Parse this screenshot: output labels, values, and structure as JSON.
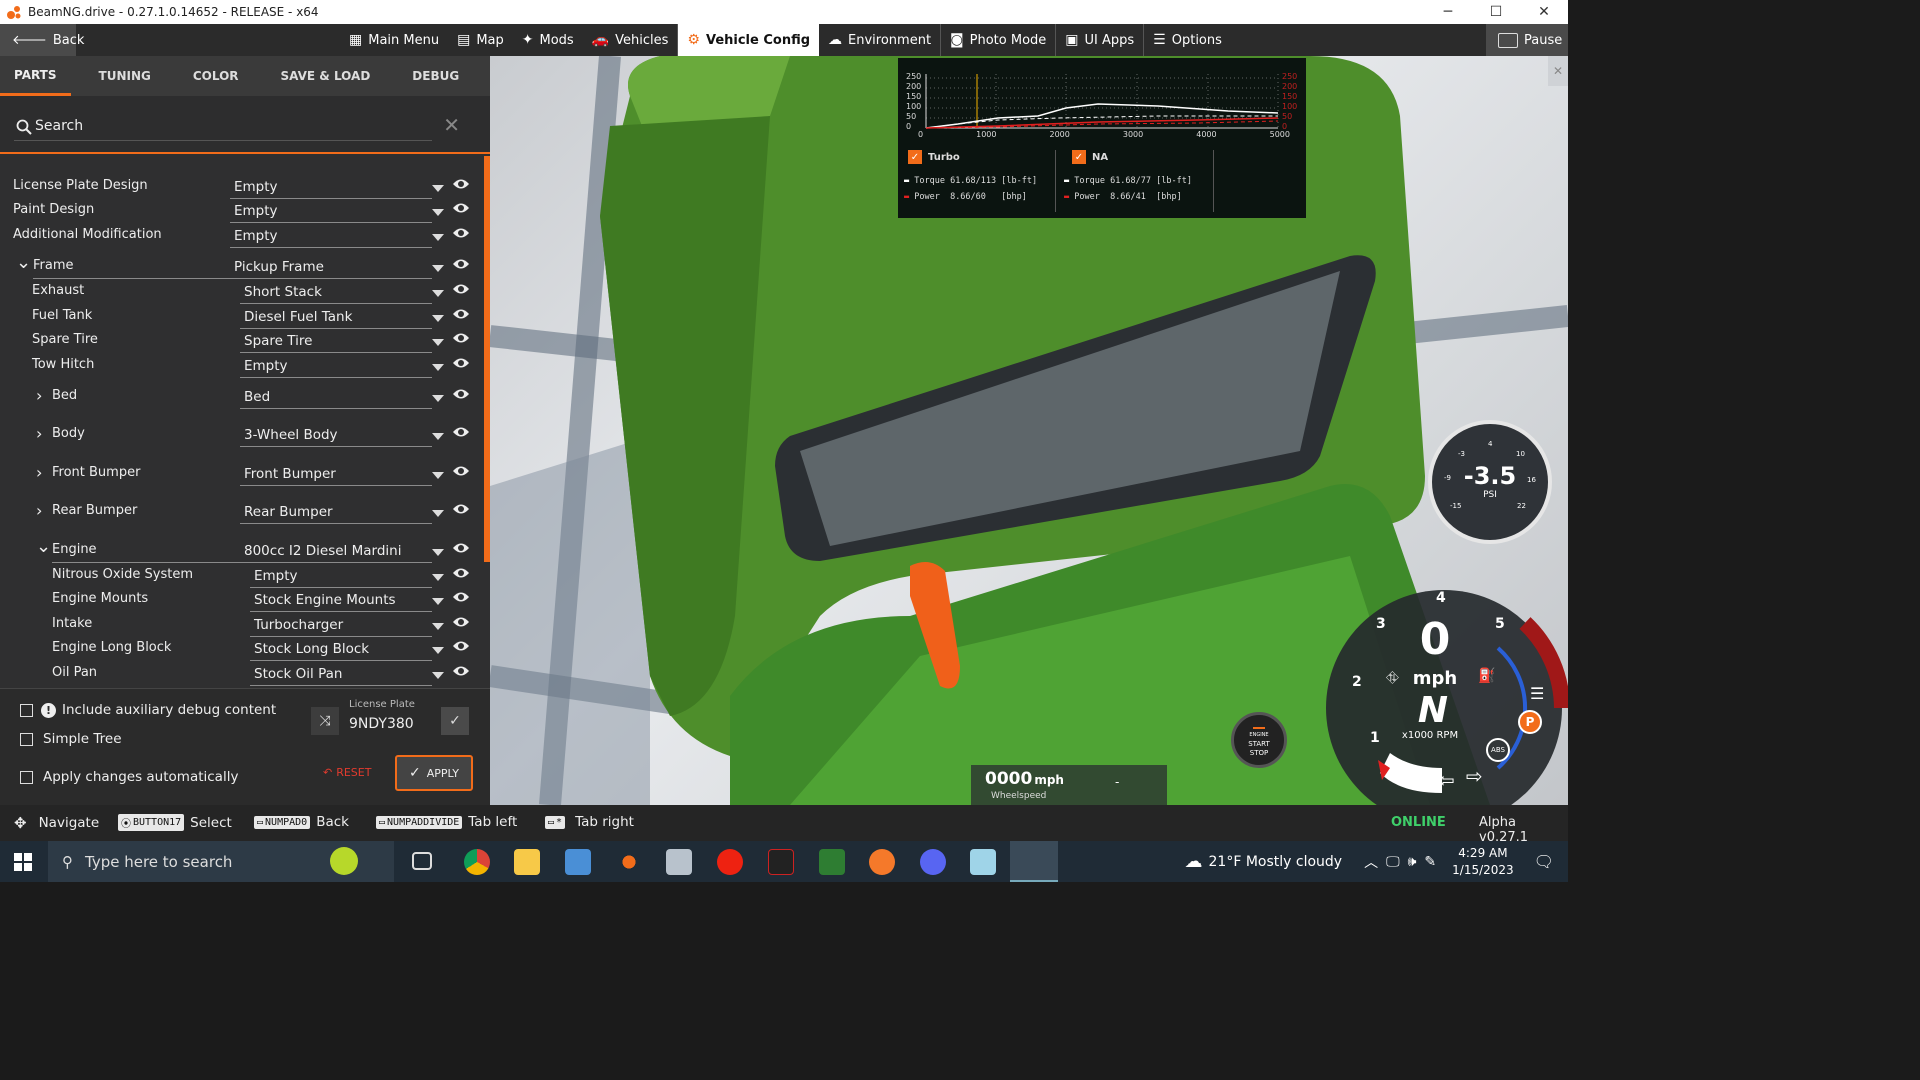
{
  "window": {
    "title": "BeamNG.drive - 0.27.1.0.14652 - RELEASE - x64",
    "minimize": "─",
    "maximize": "☐",
    "close": "✕"
  },
  "topbar": {
    "back": "Back",
    "pause": "Pause",
    "menu": [
      {
        "label": "Main Menu",
        "icon": "grid-icon"
      },
      {
        "label": "Map",
        "icon": "map-icon"
      },
      {
        "label": "Mods",
        "icon": "puzzle-icon"
      },
      {
        "label": "Vehicles",
        "icon": "car-icon"
      },
      {
        "label": "Vehicle Config",
        "icon": "engine-icon",
        "active": true
      },
      {
        "label": "Environment",
        "icon": "weather-icon"
      },
      {
        "label": "Photo Mode",
        "icon": "camera-icon"
      },
      {
        "label": "UI Apps",
        "icon": "apps-icon"
      },
      {
        "label": "Options",
        "icon": "sliders-icon"
      }
    ]
  },
  "tabs": [
    "PARTS",
    "TUNING",
    "COLOR",
    "SAVE & LOAD",
    "DEBUG"
  ],
  "search": {
    "placeholder": "Search"
  },
  "parts": [
    {
      "label": "License Plate Design",
      "value": "Empty",
      "level": 0,
      "chevron": ""
    },
    {
      "label": "Paint Design",
      "value": "Empty",
      "level": 0,
      "chevron": ""
    },
    {
      "label": "Additional Modification",
      "value": "Empty",
      "level": 0,
      "chevron": ""
    },
    {
      "label": "Frame",
      "value": "Pickup Frame",
      "level": 0,
      "chevron": "open"
    },
    {
      "label": "Exhaust",
      "value": "Short Stack",
      "level": 1,
      "chevron": ""
    },
    {
      "label": "Fuel Tank",
      "value": "Diesel Fuel Tank",
      "level": 1,
      "chevron": ""
    },
    {
      "label": "Spare Tire",
      "value": "Spare Tire",
      "level": 1,
      "chevron": ""
    },
    {
      "label": "Tow Hitch",
      "value": "Empty",
      "level": 1,
      "chevron": ""
    },
    {
      "label": "Bed",
      "value": "Bed",
      "level": 1,
      "chevron": "closed"
    },
    {
      "label": "Body",
      "value": "3-Wheel Body",
      "level": 1,
      "chevron": "closed"
    },
    {
      "label": "Front Bumper",
      "value": "Front Bumper",
      "level": 1,
      "chevron": "closed"
    },
    {
      "label": "Rear Bumper",
      "value": "Rear Bumper",
      "level": 1,
      "chevron": "closed"
    },
    {
      "label": "Engine",
      "value": "800cc I2 Diesel Mardini",
      "level": 1,
      "chevron": "open"
    },
    {
      "label": "Nitrous Oxide System",
      "value": "Empty",
      "level": 2,
      "chevron": ""
    },
    {
      "label": "Engine Mounts",
      "value": "Stock Engine Mounts",
      "level": 2,
      "chevron": ""
    },
    {
      "label": "Intake",
      "value": "Turbocharger",
      "level": 2,
      "chevron": ""
    },
    {
      "label": "Engine Long Block",
      "value": "Stock Long Block",
      "level": 2,
      "chevron": ""
    },
    {
      "label": "Oil Pan",
      "value": "Stock Oil Pan",
      "level": 2,
      "chevron": ""
    }
  ],
  "options": {
    "debug": "Include auxiliary debug content",
    "simple_tree": "Simple Tree",
    "auto_apply": "Apply changes automatically",
    "license_label": "License Plate",
    "license_value": "9NDY380",
    "reset": "RESET",
    "apply": "APPLY"
  },
  "statusbar": {
    "navigate": "Navigate",
    "select_key": "BUTTON17",
    "select": "Select",
    "back_key": "NUMPAD0",
    "back": "Back",
    "tab_left_key": "NUMPADDIVIDE",
    "tab_left": "Tab left",
    "tab_right_key": "*",
    "tab_right": "Tab right",
    "online": "ONLINE",
    "version": "Alpha v0.27.1"
  },
  "graph": {
    "y_left": [
      "250",
      "200",
      "150",
      "100",
      "50",
      "0"
    ],
    "y_right": [
      "250",
      "200",
      "150",
      "100",
      "50",
      "0"
    ],
    "x": [
      "0",
      "1000",
      "2000",
      "3000",
      "4000",
      "5000"
    ],
    "turbo": {
      "name": "Turbo",
      "torque": "Torque 61.68/113 [lb-ft]",
      "power": "Power  8.66/60   [bhp]"
    },
    "na": {
      "name": "NA",
      "torque": "Torque 61.68/77 [lb-ft]",
      "power": "Power  8.66/41  [bhp]"
    }
  },
  "hud": {
    "boost": "-3.5",
    "boost_unit": "PSI",
    "boost_ticks": [
      "-9",
      "-3",
      "4",
      "10",
      "16",
      "22",
      "-15"
    ],
    "speed": "0",
    "speed_unit": "mph",
    "gear": "N",
    "rpm_label": "x1000 RPM",
    "rpm_ticks": [
      "1",
      "2",
      "3",
      "4",
      "5"
    ],
    "wheelspeed": "0000",
    "wheelspeed_unit": "mph",
    "wheelspeed_label": "Wheelspeed",
    "wheelspeed_extra": "-",
    "engine_btn": [
      "ENGINE",
      "START",
      "STOP"
    ],
    "abs": "ABS",
    "park": "P"
  },
  "taskbar": {
    "search": "Type here to search",
    "weather": "21°F  Mostly cloudy",
    "time": "4:29 AM",
    "date": "1/15/2023"
  }
}
